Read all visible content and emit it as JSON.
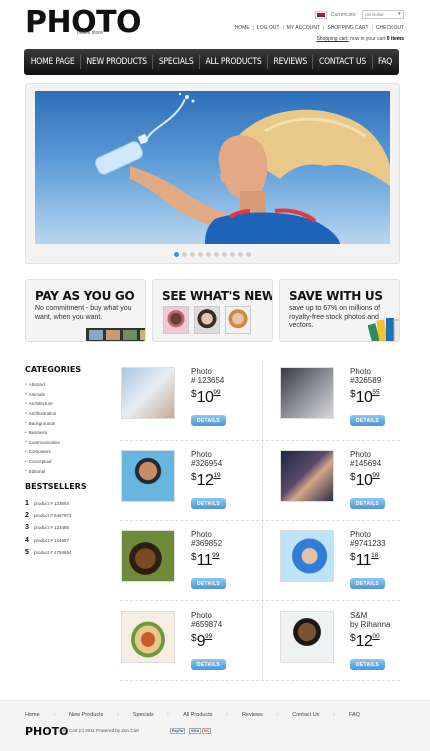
{
  "header": {
    "logo": "PHOTO",
    "logo_sub": "online store",
    "currency_label": "Currencies:",
    "currency_value": "US Dollar",
    "account_links": [
      "HOME",
      "LOG OUT",
      "MY ACCOUNT",
      "SHOPPING CART",
      "CHECKOUT"
    ],
    "cart_link": "Shopping cart:",
    "cart_text": "now in your cart",
    "cart_count": "0 items"
  },
  "nav": [
    "HOME PAGE",
    "NEW PRODUCTS",
    "SPECIALS",
    "ALL PRODUCTS",
    "REVIEWS",
    "CONTACT US",
    "FAQ"
  ],
  "slider": {
    "total_dots": 10,
    "active_index": 0
  },
  "promos": [
    {
      "title": "PAY AS YOU GO",
      "text": "No commitment - buy what you want, when you want."
    },
    {
      "title": "SEE WHAT'S NEW",
      "text": ""
    },
    {
      "title": "SAVE WITH US",
      "text": "save up to 67% on millions of royalty-free stock photos and vectors."
    }
  ],
  "sidebar": {
    "categories_title": "CATEGORIES",
    "categories": [
      "Abstract",
      "Animals",
      "Architecture",
      "Art/Illustration",
      "Backgrounds",
      "Business",
      "Communication",
      "Computers",
      "Conceptual",
      "Editorial"
    ],
    "bestsellers_title": "BESTSELLERS",
    "bestsellers": [
      {
        "num": "1",
        "label": "product # 123654"
      },
      {
        "num": "2",
        "label": "product # 5467972"
      },
      {
        "num": "3",
        "label": "product # 123486"
      },
      {
        "num": "4",
        "label": "product # 124657"
      },
      {
        "num": "5",
        "label": "product # 4794654"
      }
    ]
  },
  "products": [
    {
      "name": "Photo\n# 123654",
      "dollars": "10",
      "cents": "99",
      "button": "DETAILS"
    },
    {
      "name": "Photo\n#326589",
      "dollars": "10",
      "cents": "55",
      "button": "DETAILS"
    },
    {
      "name": "Photo\n#326954",
      "dollars": "12",
      "cents": "19",
      "button": "DETAILS"
    },
    {
      "name": "Photo\n#145694",
      "dollars": "10",
      "cents": "99",
      "button": "DETAILS"
    },
    {
      "name": "Photo\n#369852",
      "dollars": "11",
      "cents": "99",
      "button": "DETAILS"
    },
    {
      "name": "Photo\n#9741233",
      "dollars": "11",
      "cents": "18",
      "button": "DETAILS"
    },
    {
      "name": "Photo\n#659874",
      "dollars": "9",
      "cents": "99",
      "button": "DETAILS"
    },
    {
      "name": "S&M\nby Rihanna",
      "dollars": "12",
      "cents": "00",
      "button": "DETAILS"
    }
  ],
  "footer": {
    "links": [
      "Home",
      "New Products",
      "Specials",
      "All Products",
      "Reviews",
      "Contact Us",
      "FAQ"
    ],
    "logo": "PHOTO",
    "copyright": "Zen Cart (c) 2011  Powered by Zen Cart",
    "payments": [
      "PayPal",
      "VISA",
      "MC"
    ]
  },
  "colors": {
    "accent": "#4d98d2",
    "nav_bg": "#1a1a1a",
    "sky": "#3f86cc"
  }
}
